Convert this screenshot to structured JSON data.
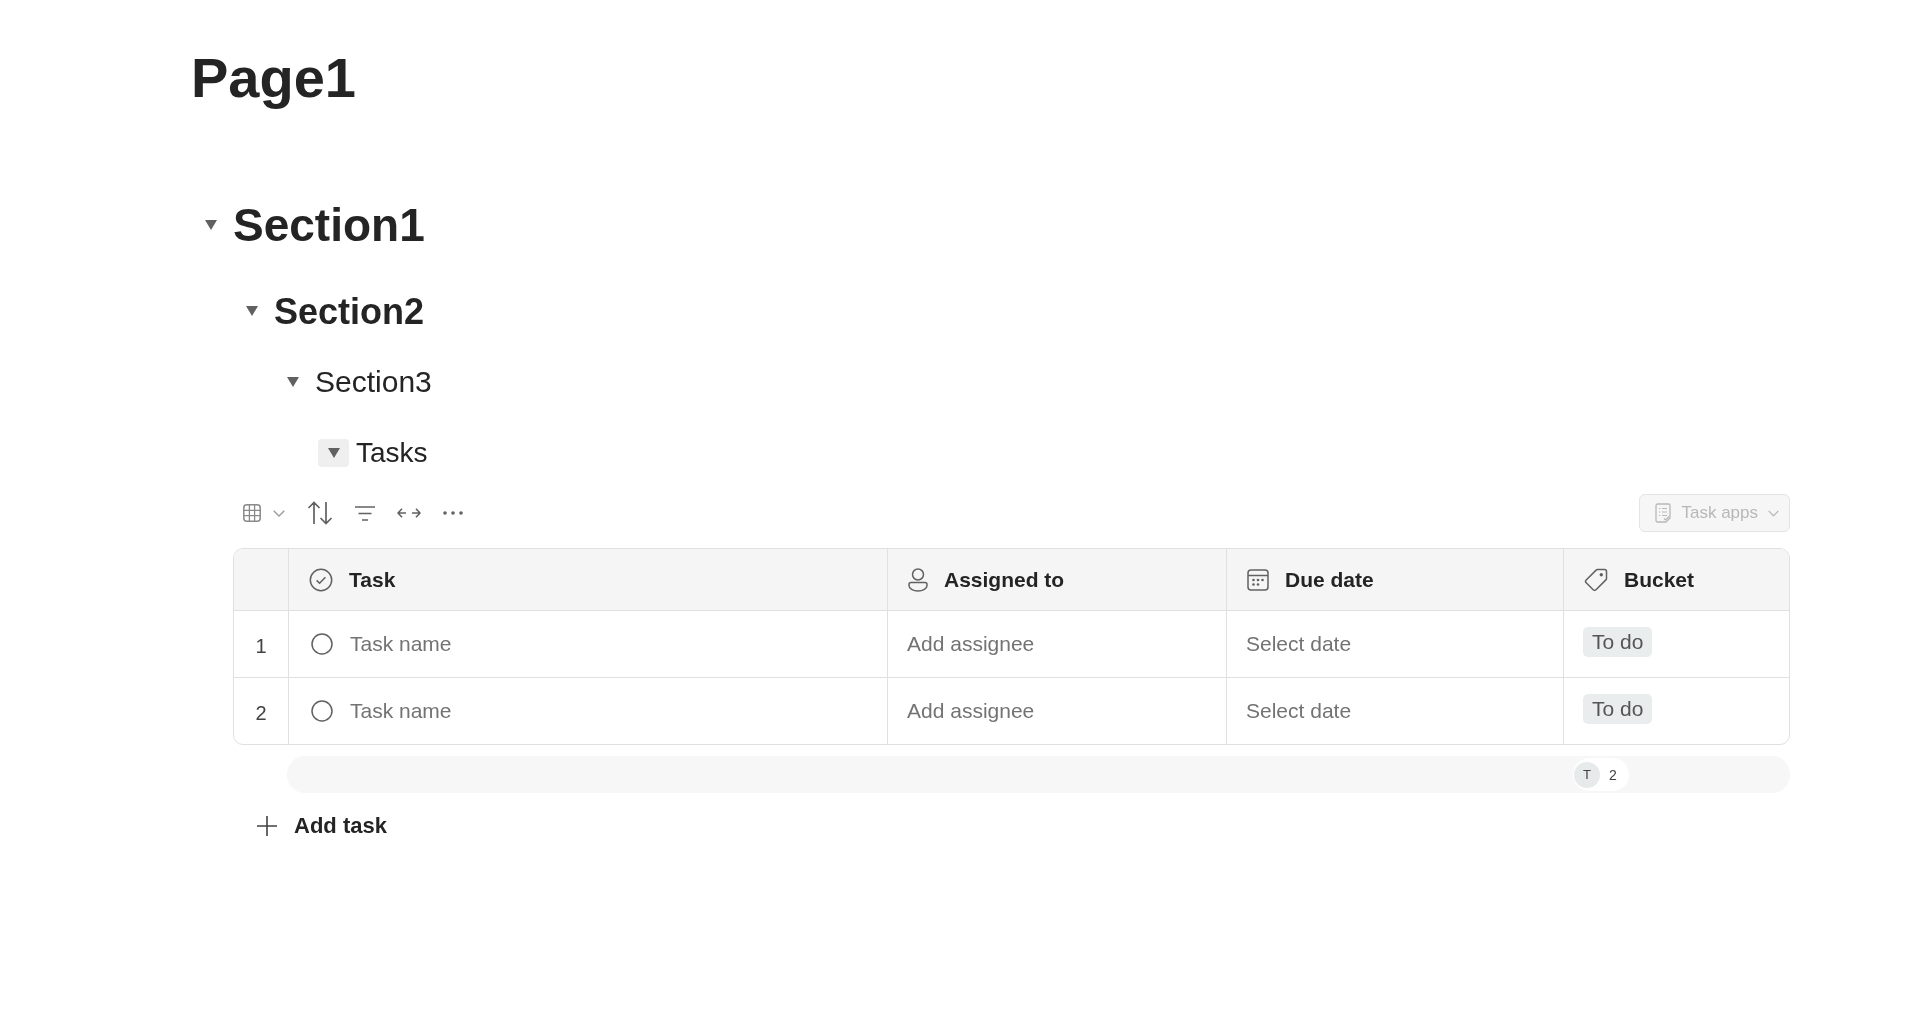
{
  "page": {
    "title": "Page1"
  },
  "outline": [
    {
      "title": "Section1",
      "expanded": true,
      "hovered": false,
      "children": [
        {
          "title": "Section2",
          "expanded": true,
          "hovered": false,
          "children": [
            {
              "title": "Section3",
              "expanded": true,
              "hovered": false,
              "children": [
                {
                  "title": "Tasks",
                  "expanded": true,
                  "hovered": true
                }
              ]
            }
          ]
        }
      ]
    }
  ],
  "task_list": {
    "apps_button": {
      "label": "Task apps",
      "disabled": true
    },
    "columns": [
      {
        "label": "Task",
        "kind": "task"
      },
      {
        "label": "Assigned to",
        "kind": "person"
      },
      {
        "label": "Due date",
        "kind": "date"
      },
      {
        "label": "Bucket",
        "kind": "bucket"
      }
    ],
    "rows": [
      {
        "number": "1",
        "completed": false,
        "task": {
          "placeholder": "Task name"
        },
        "assigned_to": {
          "placeholder": "Add assignee"
        },
        "due_date": {
          "placeholder": "Select date"
        },
        "bucket": "To do"
      },
      {
        "number": "2",
        "completed": false,
        "task": {
          "placeholder": "Task name"
        },
        "assigned_to": {
          "placeholder": "Add assignee"
        },
        "due_date": {
          "placeholder": "Select date"
        },
        "bucket": "To do"
      }
    ],
    "summary": {
      "initial": "T",
      "count": "2"
    },
    "add_button": {
      "label": "Add task"
    }
  }
}
